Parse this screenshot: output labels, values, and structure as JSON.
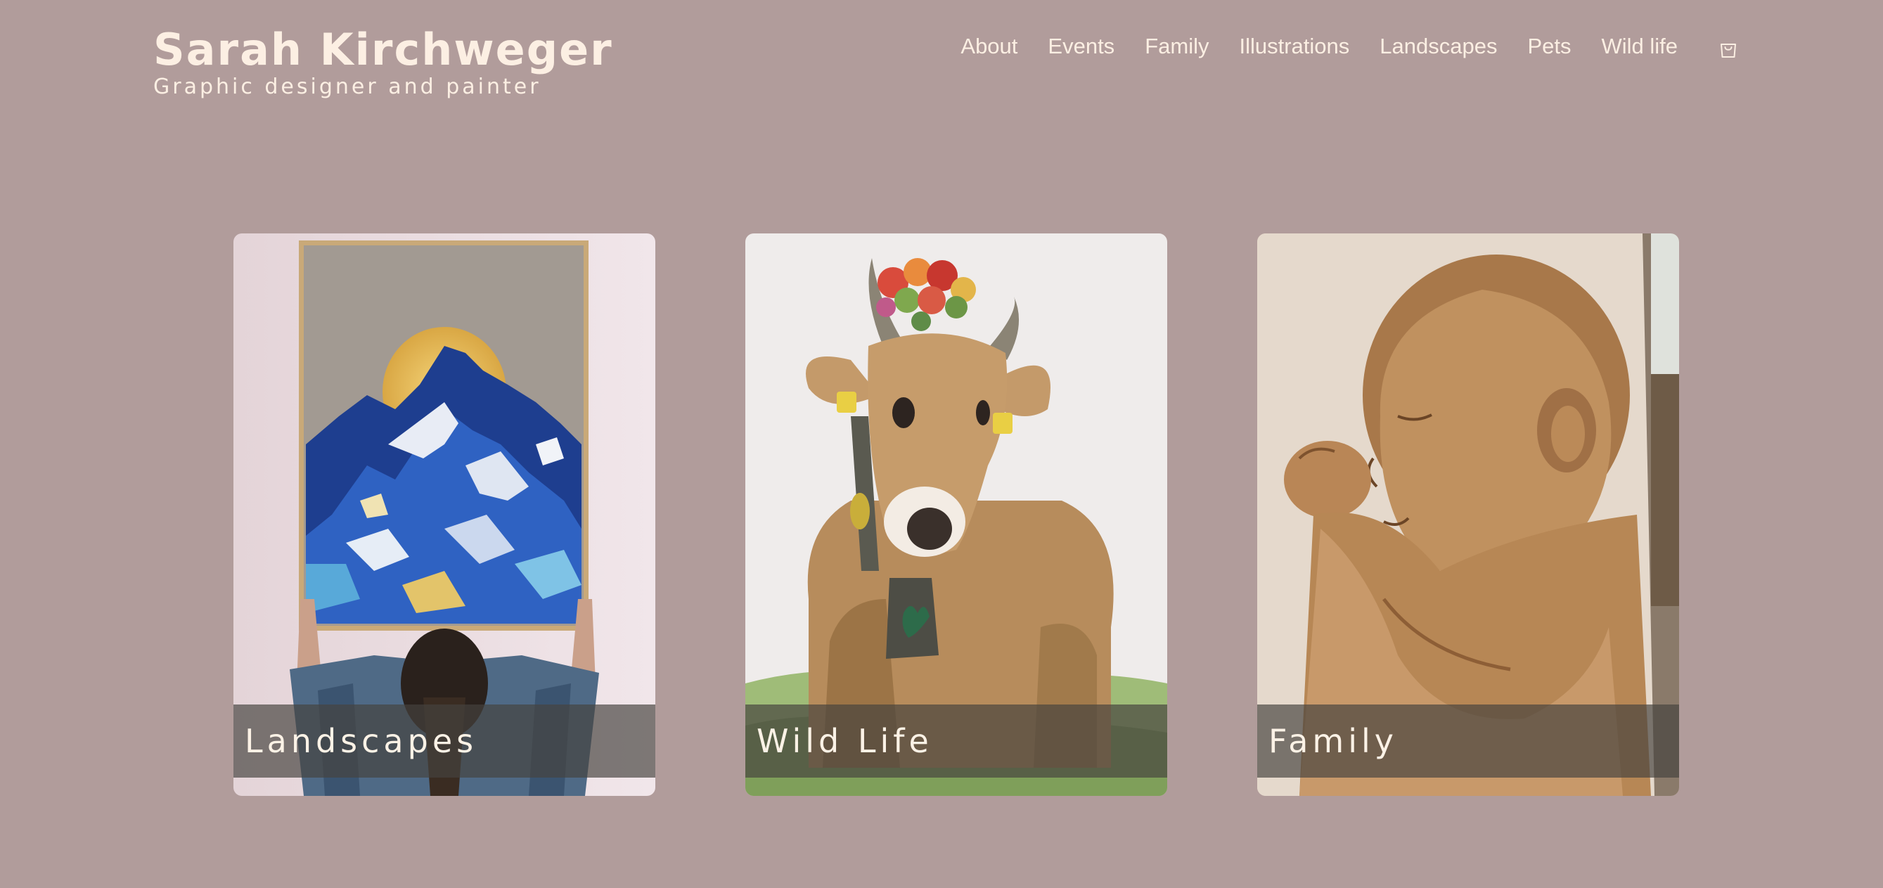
{
  "site": {
    "title": "Sarah Kirchweger",
    "tagline": "Graphic designer and painter"
  },
  "nav": {
    "items": [
      {
        "label": "About"
      },
      {
        "label": "Events"
      },
      {
        "label": "Family"
      },
      {
        "label": "Illustrations"
      },
      {
        "label": "Landscapes"
      },
      {
        "label": "Pets"
      },
      {
        "label": "Wild life"
      }
    ],
    "cart_icon": "shopping-bag-icon"
  },
  "gallery": {
    "cards": [
      {
        "caption": "Landscapes",
        "image": "mountain-painting-being-hung"
      },
      {
        "caption": "Wild Life",
        "image": "watercolor-cow-with-flower-crown"
      },
      {
        "caption": "Family",
        "image": "sepia-baby-portrait"
      }
    ]
  },
  "colors": {
    "background": "#b19c9b",
    "text": "#fcefe3",
    "caption_overlay": "rgba(70,66,62,0.68)"
  }
}
